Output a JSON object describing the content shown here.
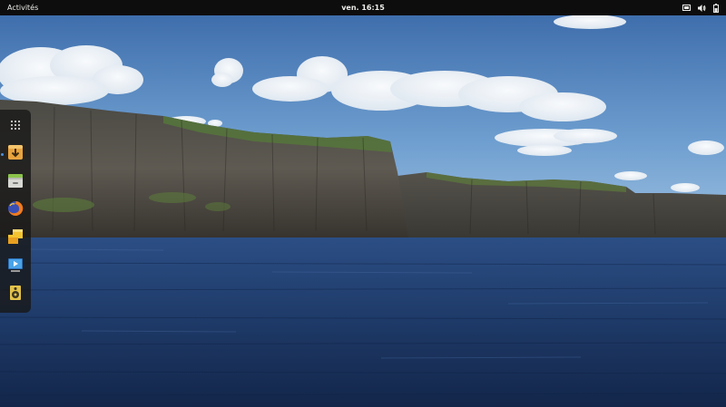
{
  "topbar": {
    "activities_label": "Activités",
    "clock": "ven. 16:15",
    "status_icons": [
      "display-icon",
      "volume-icon",
      "battery-icon"
    ]
  },
  "dash": {
    "items": [
      {
        "name": "show-applications",
        "icon": "app-grid-icon"
      },
      {
        "name": "software-installer",
        "icon": "download-installer-icon",
        "running": true
      },
      {
        "name": "file-manager",
        "icon": "files-drawer-icon"
      },
      {
        "name": "firefox",
        "icon": "firefox-icon"
      },
      {
        "name": "software-boxes",
        "icon": "software-boxes-icon"
      },
      {
        "name": "video-player",
        "icon": "video-player-icon"
      },
      {
        "name": "audio-player",
        "icon": "speaker-icon"
      }
    ]
  },
  "colors": {
    "topbar_bg": "#0d0d0d",
    "topbar_text": "#eeeeec",
    "dash_bg": "#181818",
    "running_indicator": "#4a90d9",
    "sky": "#3f73b2",
    "sea": "#1f3c6a",
    "cliff": "#4d4a45"
  }
}
